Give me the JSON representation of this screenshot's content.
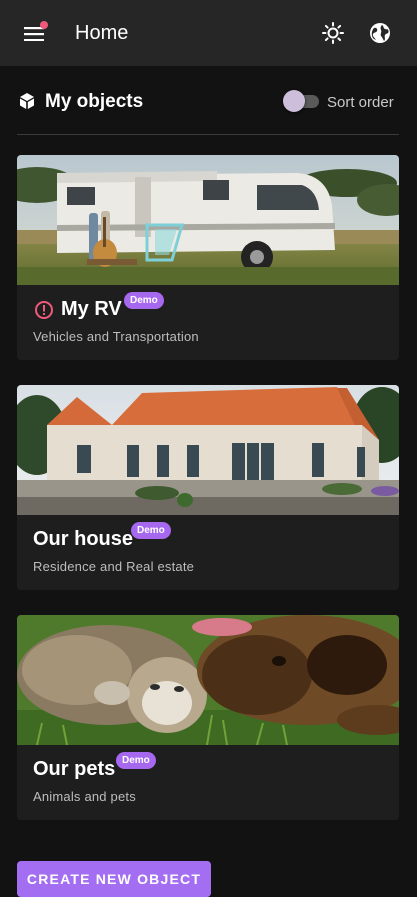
{
  "appbar": {
    "title": "Home",
    "menu_icon": "menu-icon",
    "theme_icon": "brightness-icon",
    "language_icon": "globe-icon",
    "notification_color": "#ef5a7a"
  },
  "section": {
    "title": "My objects",
    "sort_label": "Sort order",
    "sort_toggle_on": false
  },
  "cards": [
    {
      "title": "My RV",
      "badge": "Demo",
      "subtitle": "Vehicles and Transportation",
      "has_warning": true,
      "image": "rv-photo"
    },
    {
      "title": "Our house",
      "badge": "Demo",
      "subtitle": "Residence and Real estate",
      "has_warning": false,
      "image": "house-photo"
    },
    {
      "title": "Our pets",
      "badge": "Demo",
      "subtitle": "Animals and pets",
      "has_warning": false,
      "image": "pets-photo"
    }
  ],
  "create_button": "CREATE NEW OBJECT",
  "colors": {
    "accent": "#a46ef2",
    "badge": "#a768f0",
    "warning": "#ef5a7a",
    "background": "#121212",
    "card": "#1e1e1e",
    "appbar": "#262626"
  }
}
